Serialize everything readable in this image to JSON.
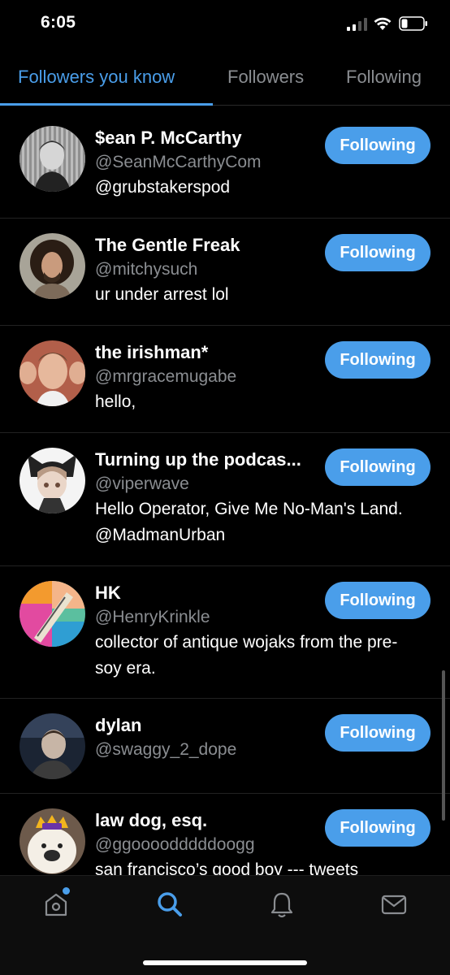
{
  "status": {
    "time": "6:05"
  },
  "tabs": [
    {
      "label": "Followers you know",
      "active": true
    },
    {
      "label": "Followers",
      "active": false
    },
    {
      "label": "Following",
      "active": false
    }
  ],
  "users": [
    {
      "name": "$ean P. McCarthy",
      "handle": "@SeanMcCarthyCom",
      "bio": "@grubstakerspod",
      "button": "Following"
    },
    {
      "name": "The Gentle Freak",
      "handle": "@mitchysuch",
      "bio": "ur under arrest lol",
      "button": "Following"
    },
    {
      "name": "the irishman*",
      "handle": "@mrgracemugabe",
      "bio": "hello,",
      "button": "Following"
    },
    {
      "name": "Turning up the podcas...",
      "handle": "@viperwave",
      "bio": "Hello Operator, Give Me No-Man's Land. @MadmanUrban",
      "button": "Following"
    },
    {
      "name": "HK",
      "handle": "@HenryKrinkle",
      "bio": "collector of antique wojaks from the pre-soy era.",
      "button": "Following"
    },
    {
      "name": "dylan",
      "handle": "@swaggy_2_dope",
      "bio": "",
      "button": "Following"
    },
    {
      "name": "law dog, esq.",
      "handle": "@ggoooodddddoogg",
      "bio": "san francisco’s good boy --- tweets",
      "button": "Following"
    }
  ],
  "nav": [
    "home-icon",
    "search-icon",
    "bell-icon",
    "mail-icon"
  ],
  "colors": {
    "accent": "#4a9eea",
    "background": "#000000",
    "muted": "#8a8d91"
  }
}
